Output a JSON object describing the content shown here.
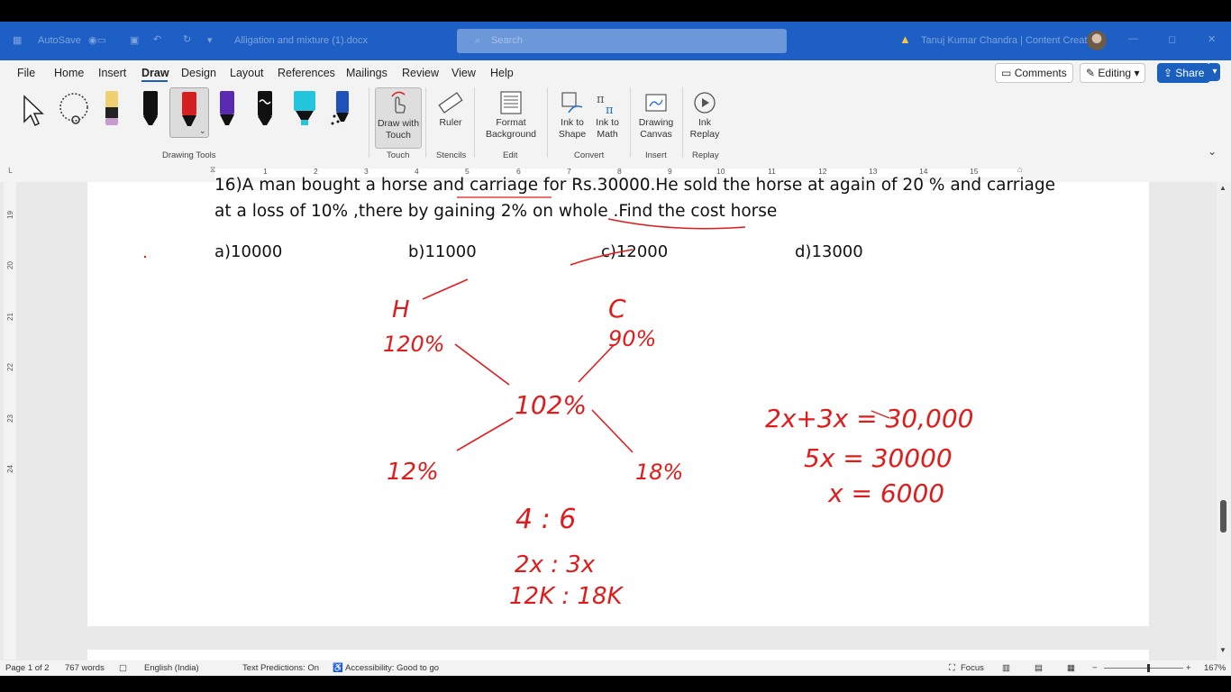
{
  "titlebar": {
    "autosave": "AutoSave",
    "doc_title": "Alligation and mixture (1).docx",
    "search_placeholder": "Search",
    "user_status": "Tanuj Kumar Chandra | Content Creation"
  },
  "ribbon": {
    "tabs": [
      "File",
      "Home",
      "Insert",
      "Draw",
      "Design",
      "Layout",
      "References",
      "Mailings",
      "Review",
      "View",
      "Help"
    ],
    "active_tab": "Draw",
    "comments_label": "Comments",
    "editing_label": "Editing",
    "share_label": "Share",
    "tools": {
      "draw_with_touch": "Draw with Touch",
      "ruler": "Ruler",
      "format_background": "Format Background",
      "ink_to_shape": "Ink to Shape",
      "ink_to_math": "Ink to Math",
      "drawing_canvas": "Drawing Canvas",
      "ink_replay": "Ink Replay"
    },
    "groups": {
      "drawing_tools": "Drawing Tools",
      "touch": "Touch",
      "stencils": "Stencils",
      "edit": "Edit",
      "convert": "Convert",
      "insert": "Insert",
      "replay": "Replay"
    },
    "pen_colors": [
      "#f0d070",
      "#111111",
      "#d32020",
      "#5a2ab0",
      "#111111",
      "#22c5dc",
      "#1f52b8"
    ]
  },
  "ruler": {
    "numbers": [
      "1",
      "2",
      "3",
      "4",
      "5",
      "6",
      "7",
      "8",
      "9",
      "10",
      "11",
      "12",
      "13",
      "14",
      "15"
    ]
  },
  "vruler": {
    "numbers": [
      "19",
      "20",
      "21",
      "22",
      "23",
      "24"
    ]
  },
  "document": {
    "question_line1": "16)A man bought a horse and carriage  for Rs.30000.He sold the horse at again of 20 % and carriage",
    "question_line2_a": "at a loss of 10% ,there by gaining 2% on whole .",
    "question_line2_b": "Find the cost horse",
    "options": [
      "a)10000",
      "b)11000",
      "c)12000",
      "d)13000"
    ]
  },
  "ink": {
    "horse": "H",
    "carriage": "C",
    "horse_pct": "120%",
    "carriage_pct": "90%",
    "mean_pct": "102%",
    "left_diff": "12%",
    "right_diff": "18%",
    "ratio": "4 : 6",
    "ratio_x": "2x : 3x",
    "ratio_k": "12K : 18K",
    "eq1": "2x+3x = 30,000",
    "eq2": "5x = 30000",
    "eq3": "x = 6000"
  },
  "statusbar": {
    "page": "Page 1 of 2",
    "words": "767 words",
    "language": "English (India)",
    "predictions": "Text Predictions: On",
    "accessibility": "Accessibility: Good to go",
    "focus": "Focus",
    "zoom": "167%"
  }
}
